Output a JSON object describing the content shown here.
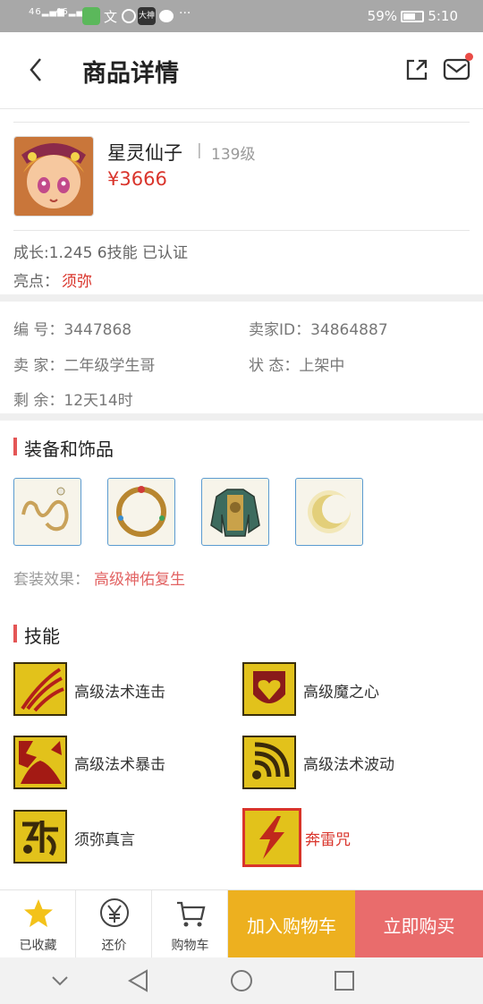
{
  "status_bar": {
    "signal1": "46",
    "signal2": "46",
    "battery": "59%",
    "time": "5:10",
    "app_badge": "大神"
  },
  "header": {
    "title": "商品详情"
  },
  "product": {
    "name": "星灵仙子",
    "separator": "|",
    "level": "139级",
    "price": "¥3666",
    "growth": "成长:1.245 6技能 已认证",
    "highlight_label": "亮点：",
    "highlight_value": "须弥"
  },
  "info": {
    "id": "编  号：3447868",
    "seller_id": "卖家ID：34864887",
    "seller": "卖  家：二年级学生哥",
    "status": "状  态：上架中",
    "remaining": "剩  余：12天14时"
  },
  "equipment": {
    "title": "装备和饰品",
    "items": [
      "necklace-icon",
      "ring-icon",
      "armor-icon",
      "moon-ornament-icon"
    ],
    "set_label": "套装效果：",
    "set_value": "高级神佑复生"
  },
  "skills": {
    "title": "技能",
    "items": [
      {
        "label": "高级法术连击",
        "icon": "claw-slash-icon"
      },
      {
        "label": "高级魔之心",
        "icon": "heart-emblem-icon"
      },
      {
        "label": "高级法术暴击",
        "icon": "burst-icon"
      },
      {
        "label": "高级法术波动",
        "icon": "wave-icon"
      },
      {
        "label": "须弥真言",
        "icon": "rune-icon"
      },
      {
        "label": "奔雷咒",
        "icon": "lightning-icon",
        "highlighted": true
      }
    ]
  },
  "bottom_bar": {
    "favorite": "已收藏",
    "bargain": "还价",
    "cart": "购物车",
    "add_to_cart": "加入购物车",
    "buy_now": "立即购买"
  },
  "colors": {
    "accent_red": "#d9342b",
    "cart_orange": "#edb01f",
    "buy_pink": "#e96c6c"
  }
}
